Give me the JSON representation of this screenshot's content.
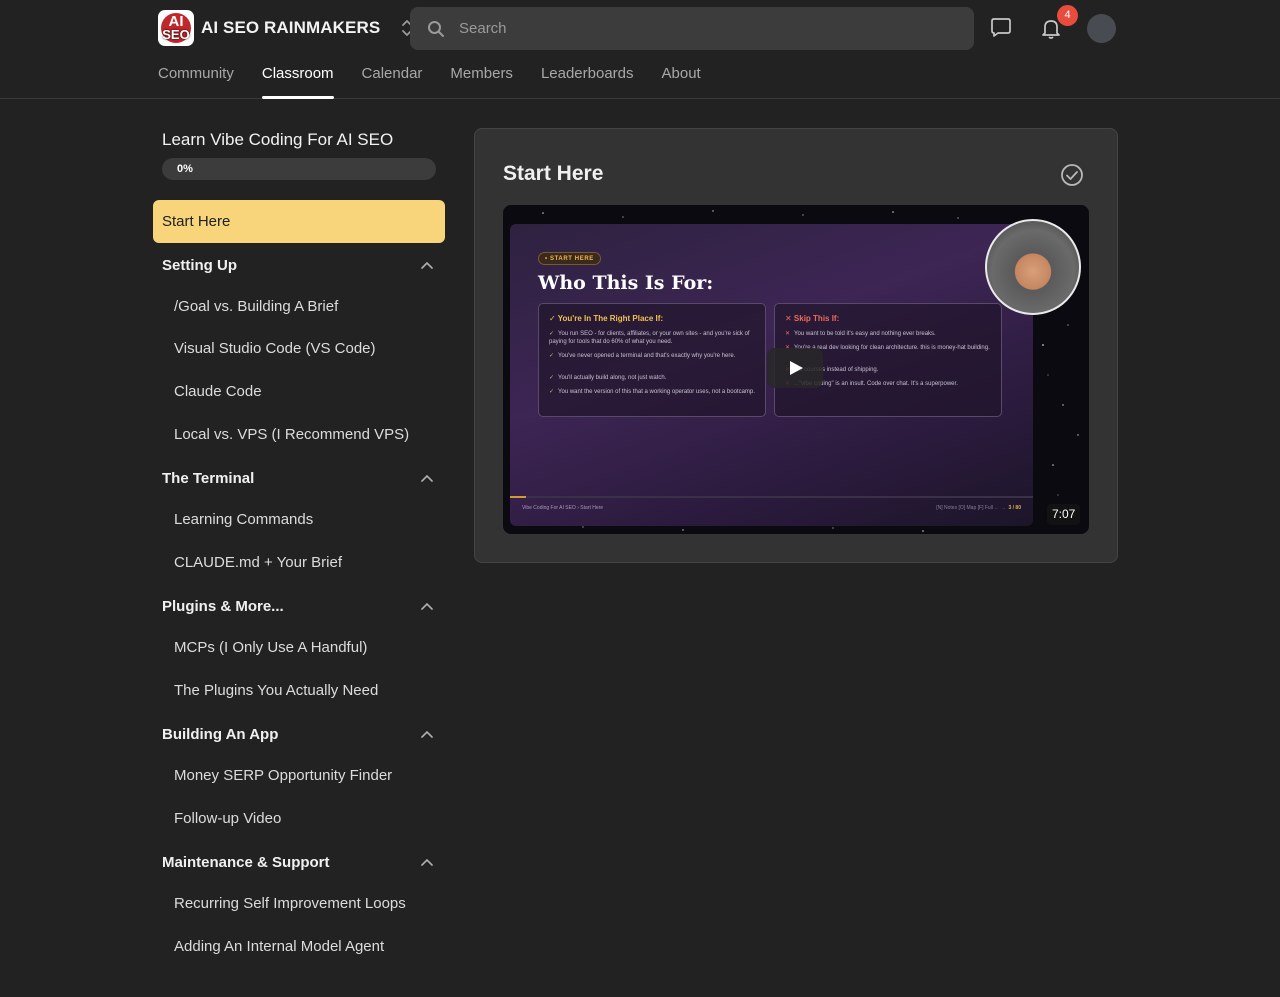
{
  "header": {
    "logo_top": "AI",
    "logo_bottom": "SEO",
    "community_name": "AI SEO RAINMAKERS",
    "search_placeholder": "Search",
    "notification_count": "4"
  },
  "nav": {
    "tabs": [
      {
        "label": "Community",
        "active": false
      },
      {
        "label": "Classroom",
        "active": true
      },
      {
        "label": "Calendar",
        "active": false
      },
      {
        "label": "Members",
        "active": false
      },
      {
        "label": "Leaderboards",
        "active": false
      },
      {
        "label": "About",
        "active": false
      }
    ]
  },
  "course": {
    "title": "Learn Vibe Coding For AI SEO",
    "progress_label": "0%",
    "progress_value": 0,
    "active_lesson": "Start Here",
    "sections": [
      {
        "title": "Setting Up",
        "lessons": [
          "/Goal vs. Building A Brief",
          "Visual Studio Code (VS Code)",
          "Claude Code",
          "Local vs. VPS (I Recommend VPS)"
        ]
      },
      {
        "title": "The Terminal",
        "lessons": [
          "Learning Commands",
          "CLAUDE.md + Your Brief"
        ]
      },
      {
        "title": "Plugins & More...",
        "lessons": [
          "MCPs (I Only Use A Handful)",
          "The Plugins You Actually Need"
        ]
      },
      {
        "title": "Building An App",
        "lessons": [
          "Money SERP Opportunity Finder",
          "Follow-up Video"
        ]
      },
      {
        "title": "Maintenance & Support",
        "lessons": [
          "Recurring Self Improvement Loops",
          "Adding An Internal Model Agent"
        ]
      }
    ]
  },
  "lesson": {
    "title": "Start Here",
    "video": {
      "duration": "7:07",
      "slide_pill": "• START HERE",
      "slide_heading": "Who This Is For:",
      "left_box_title": "✓ You're In The Right Place If:",
      "left_items": [
        "You run SEO - for clients, affiliates, or your own sites - and you're sick of paying for tools that do 60% of what you need.",
        "You've never opened a terminal and that's exactly why you're here.",
        "You'll actually build along, not just watch.",
        "You want the version of this that a working operator uses, not a bootcamp."
      ],
      "right_box_title": "✕ Skip This If:",
      "right_items": [
        "You want to be told it's easy and nothing ever breaks.",
        "You're a real dev looking for clean architecture. this is money-hat building.",
        "...d courses instead of shipping.",
        "...\"vibe coding\" is an insult. Code over chat. It's a superpower."
      ],
      "footer_left": "Vibe Coding For AI SEO  ›  Start Here",
      "footer_right_keys": "[N] Notes   [O] Map   [F] Full   ← →",
      "footer_right_page": "3 / 80",
      "slide_progress": 0.03
    }
  },
  "colors": {
    "accent_active_lesson": "#f8d47a",
    "badge": "#e74c3c",
    "background": "#222222",
    "card": "#333333"
  }
}
